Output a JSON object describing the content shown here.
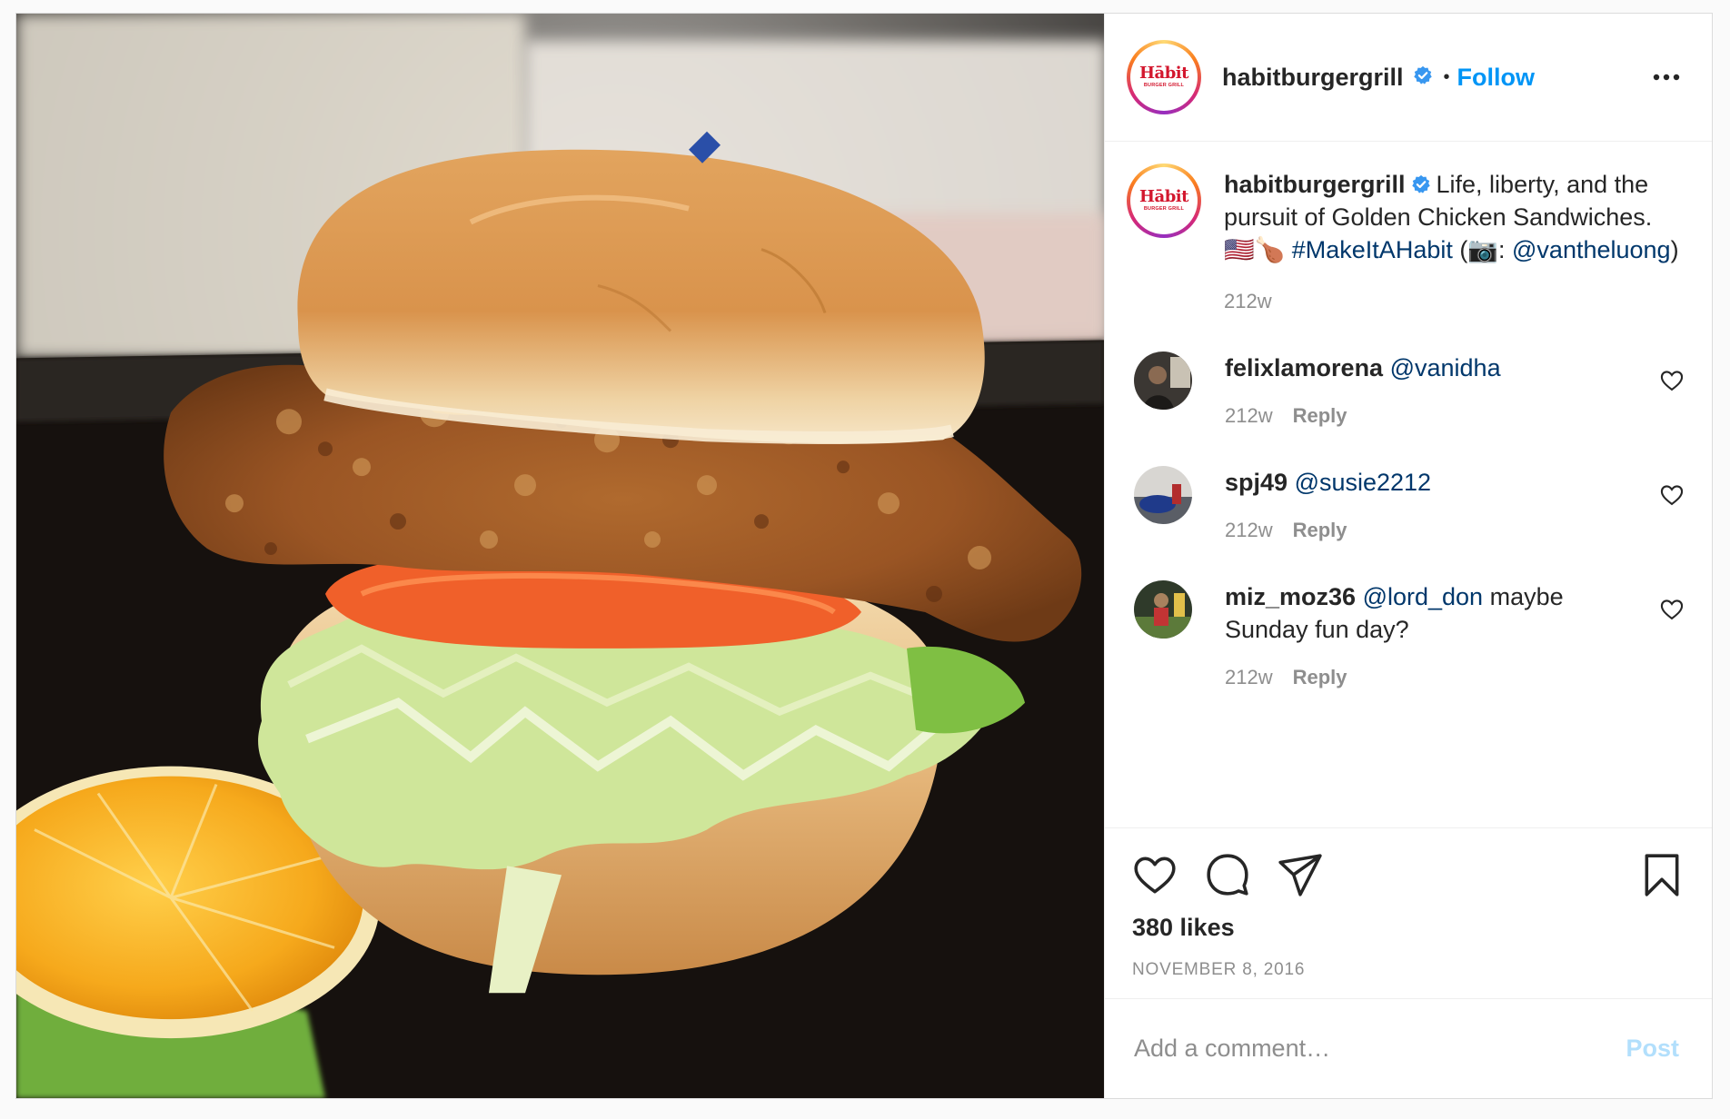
{
  "post": {
    "image_alt": "Golden chicken sandwich with tomato and lettuce next to an orange slice",
    "brand_logo": {
      "main": "Hābit",
      "sub": "BURGER GRILL"
    }
  },
  "header": {
    "username": "habitburgergrill",
    "separator": "•",
    "follow_label": "Follow",
    "more_icon": "more-dots-icon"
  },
  "caption": {
    "username": "habitburgergrill",
    "text": "Life, liberty, and the pursuit of Golden Chicken Sandwiches. 🇺🇸🍗",
    "hashtag": "#MakeItAHabit",
    "credit_prefix": "(📷:",
    "mention": "@vantheluong",
    "credit_suffix": ")",
    "time": "212w"
  },
  "comments": [
    {
      "username": "felixlamorena",
      "mention": "@vanidha",
      "text": "",
      "time": "212w",
      "reply_label": "Reply"
    },
    {
      "username": "spj49",
      "mention": "@susie2212",
      "text": "",
      "time": "212w",
      "reply_label": "Reply"
    },
    {
      "username": "miz_moz36",
      "mention": "@lord_don",
      "text": "maybe Sunday fun day?",
      "time": "212w",
      "reply_label": "Reply"
    }
  ],
  "actions": {
    "likes": "380 likes",
    "date": "NOVEMBER 8, 2016",
    "icons": [
      "heart-icon",
      "comment-icon",
      "share-icon",
      "bookmark-icon"
    ]
  },
  "add_comment": {
    "placeholder": "Add a comment…",
    "post_label": "Post"
  },
  "colors": {
    "accent": "#0095f6",
    "link": "#00376b",
    "muted": "#8e8e8e",
    "post_disabled": "#b2dffc",
    "brand_red": "#d3172e"
  }
}
